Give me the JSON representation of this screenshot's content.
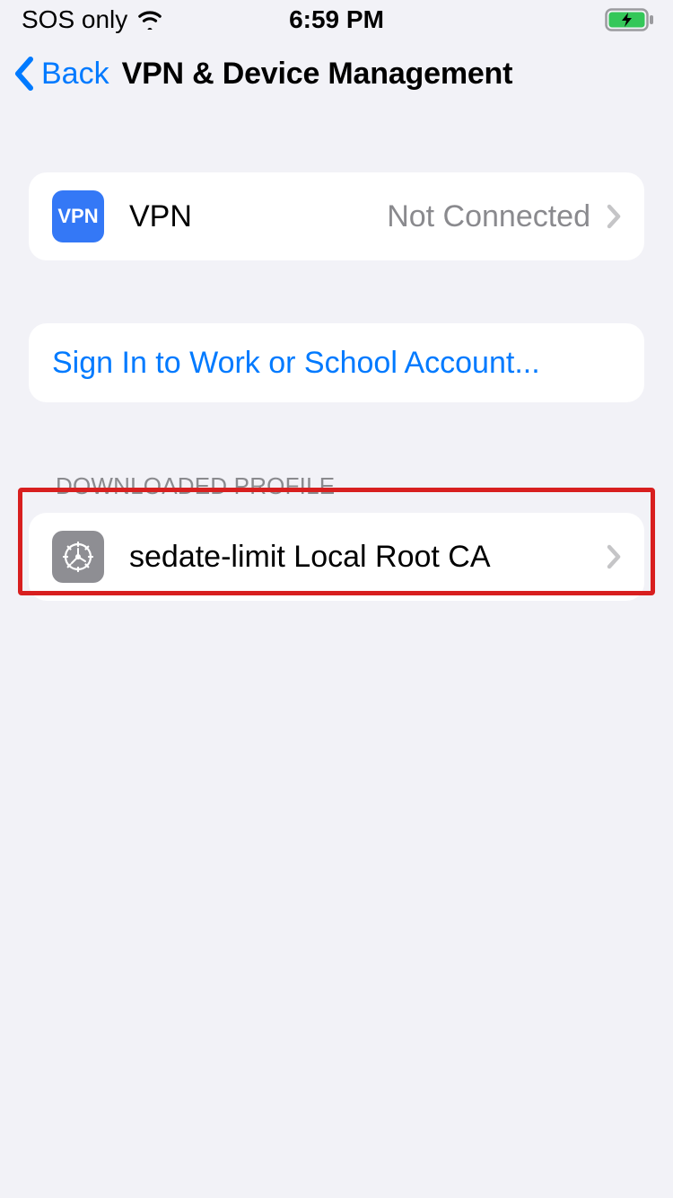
{
  "status_bar": {
    "carrier": "SOS only",
    "time": "6:59 PM"
  },
  "nav": {
    "back_label": "Back",
    "title": "VPN & Device Management"
  },
  "vpn_row": {
    "badge_text": "VPN",
    "label": "VPN",
    "value": "Not Connected"
  },
  "signin_row": {
    "label": "Sign In to Work or School Account..."
  },
  "profile_section": {
    "header": "DOWNLOADED PROFILE",
    "name": "sedate-limit Local Root CA"
  }
}
